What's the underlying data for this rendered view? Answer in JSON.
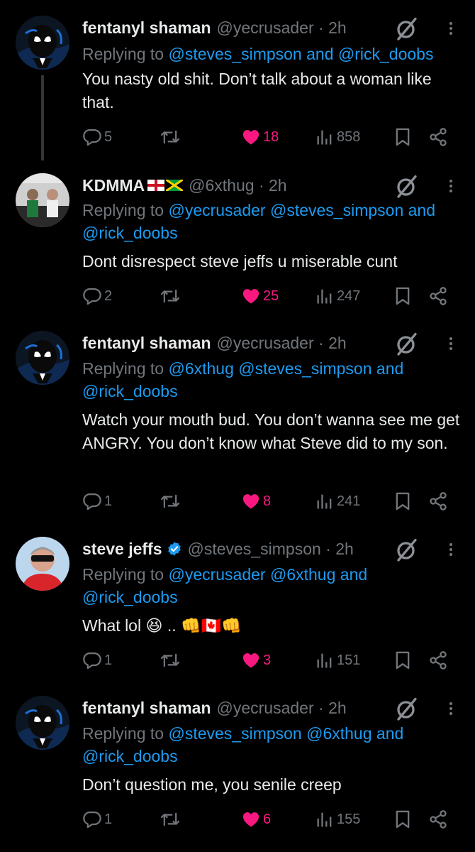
{
  "colors": {
    "background": "#000000",
    "text": "#e7e9ea",
    "muted": "#71767b",
    "link": "#1d9bf0",
    "like": "#f91880"
  },
  "tweets": [
    {
      "name": "fentanyl shaman",
      "handle": "@yecrusader · 2h",
      "reply_prefix": "Replying to ",
      "reply_mentions": "@steves_simpson and @rick_doobs",
      "text": "You nasty old shit. Don’t talk about a woman like that.",
      "replies": "5",
      "likes": "18",
      "views": "858"
    },
    {
      "name": "KDMMA",
      "handle": "@6xthug · 2h",
      "reply_prefix": "Replying to ",
      "reply_mentions": "@yecrusader @steves_simpson and @rick_doobs",
      "text": "Dont disrespect steve jeffs u miserable cunt",
      "replies": "2",
      "likes": "25",
      "views": "247"
    },
    {
      "name": "fentanyl shaman",
      "handle": "@yecrusader · 2h",
      "reply_prefix": "Replying to ",
      "reply_mentions": "@6xthug @steves_simpson and @rick_doobs",
      "text": "Watch your mouth bud. You don’t wanna see me get ANGRY. You don’t know what Steve did to my son.",
      "replies": "1",
      "likes": "8",
      "views": "241"
    },
    {
      "name": "steve jeffs",
      "handle": "@steves_simpson · 2h",
      "reply_prefix": "Replying to ",
      "reply_mentions": "@yecrusader @6xthug and @rick_doobs",
      "text": "What lol",
      "text_suffix": " 😆 .. 👊🇨🇦👊",
      "replies": "1",
      "likes": "3",
      "views": "151"
    },
    {
      "name": "fentanyl shaman",
      "handle": "@yecrusader · 2h",
      "reply_prefix": "Replying to ",
      "reply_mentions": "@steves_simpson @6xthug and @rick_doobs",
      "text": "Don’t question me, you senile creep",
      "replies": "1",
      "likes": "6",
      "views": "155"
    }
  ]
}
